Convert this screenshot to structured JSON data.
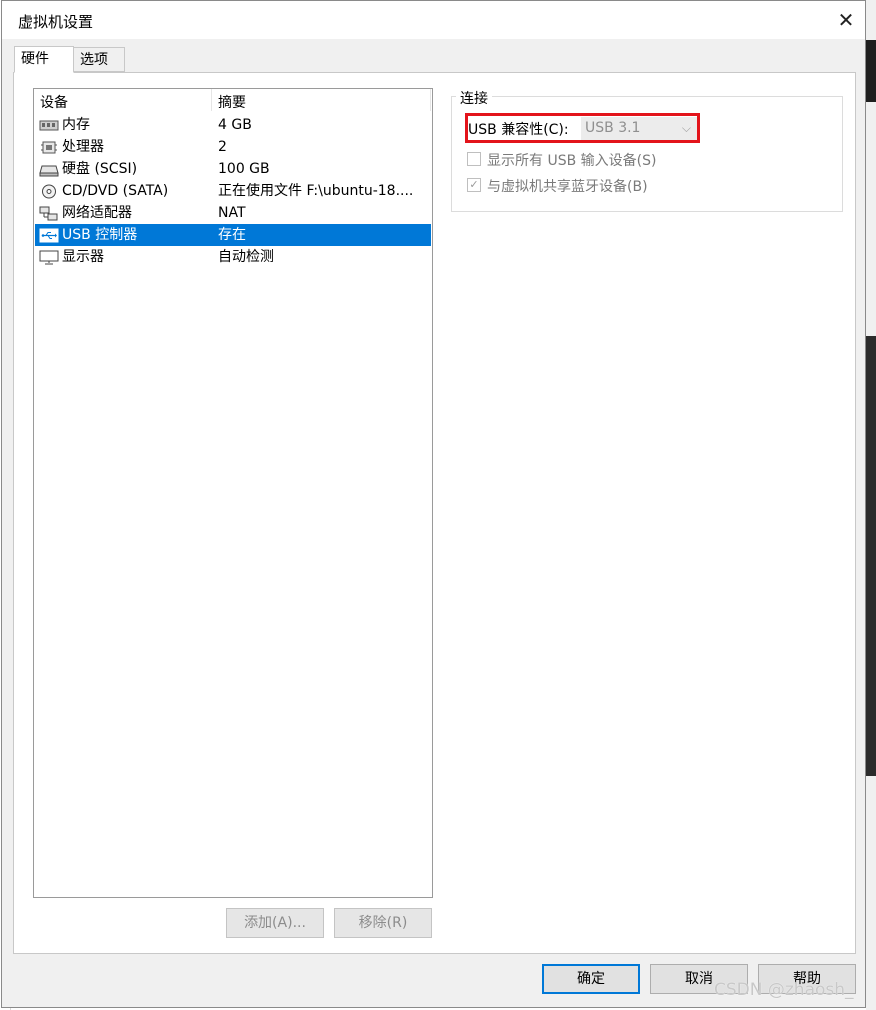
{
  "window": {
    "title": "虚拟机设置",
    "close_glyph": "✕"
  },
  "tabs": [
    {
      "label": "硬件"
    },
    {
      "label": "选项"
    }
  ],
  "device_list": {
    "headers": {
      "device": "设备",
      "summary": "摘要"
    },
    "rows": [
      {
        "name": "内存",
        "summary": "4 GB",
        "icon": "memory-icon"
      },
      {
        "name": "处理器",
        "summary": "2",
        "icon": "processor-icon"
      },
      {
        "name": "硬盘 (SCSI)",
        "summary": "100 GB",
        "icon": "hard-disk-icon"
      },
      {
        "name": "CD/DVD (SATA)",
        "summary": "正在使用文件 F:\\ubuntu-18....",
        "icon": "cd-dvd-icon"
      },
      {
        "name": "网络适配器",
        "summary": "NAT",
        "icon": "network-adapter-icon"
      },
      {
        "name": "USB 控制器",
        "summary": "存在",
        "icon": "usb-icon",
        "selected": true
      },
      {
        "name": "显示器",
        "summary": "自动检测",
        "icon": "display-icon"
      }
    ]
  },
  "list_buttons": {
    "add": "添加(A)...",
    "remove": "移除(R)"
  },
  "connection": {
    "title": "连接",
    "usb_compat_label": "USB 兼容性(C):",
    "usb_compat_value": "USB 3.1",
    "show_all_usb": {
      "label": "显示所有 USB 输入设备(S)",
      "checked": false
    },
    "share_bluetooth": {
      "label": "与虚拟机共享蓝牙设备(B)",
      "checked": true
    }
  },
  "footer_buttons": {
    "ok": "确定",
    "cancel": "取消",
    "help": "帮助"
  },
  "watermark": "CSDN @zhaosh_",
  "colors": {
    "selection": "#0078d7",
    "highlight": "#e3141b"
  }
}
